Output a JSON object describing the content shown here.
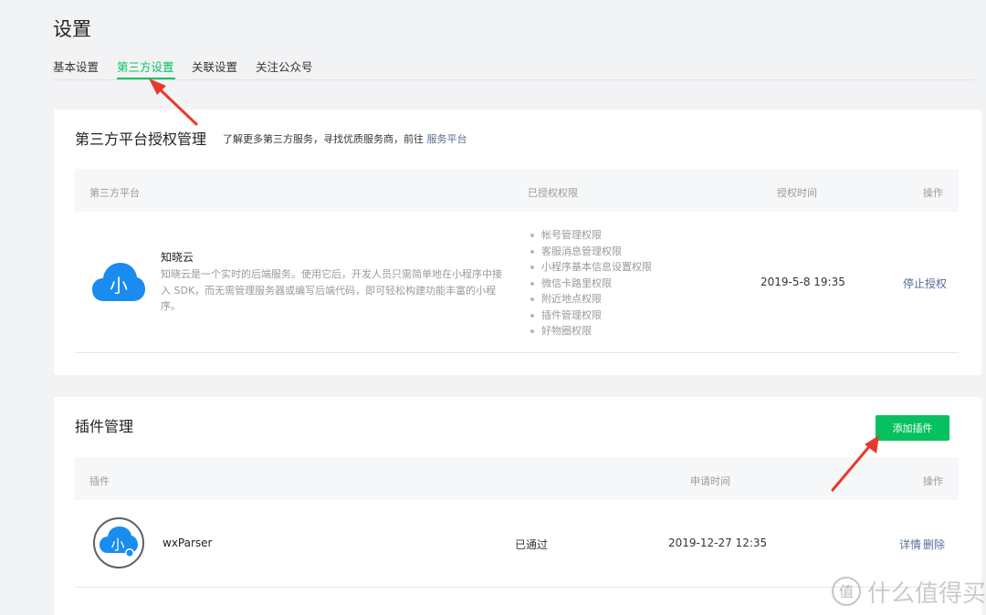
{
  "page": {
    "title": "设置"
  },
  "tabs": [
    {
      "label": "基本设置"
    },
    {
      "label": "第三方设置"
    },
    {
      "label": "关联设置"
    },
    {
      "label": "关注公众号"
    }
  ],
  "third_party": {
    "title": "第三方平台授权管理",
    "desc_prefix": "了解更多第三方服务，寻找优质服务商，前往",
    "desc_link": "服务平台",
    "columns": [
      "第三方平台",
      "已授权权限",
      "授权时间",
      "操作"
    ],
    "row": {
      "icon_glyph": "小",
      "name": "知晓云",
      "desc": "知晓云是一个实时的后端服务。使用它后，开发人员只需简单地在小程序中接入 SDK，而无需管理服务器或编写后端代码，即可轻松构建功能丰富的小程序。",
      "permissions": [
        "帐号管理权限",
        "客服消息管理权限",
        "小程序基本信息设置权限",
        "微信卡路里权限",
        "附近地点权限",
        "插件管理权限",
        "好物圈权限"
      ],
      "time": "2019-5-8 19:35",
      "action": "停止授权"
    }
  },
  "plugins": {
    "title": "插件管理",
    "add_button": "添加插件",
    "columns": [
      "插件",
      "申请时间",
      "操作"
    ],
    "row": {
      "icon_glyph": "小",
      "name": "wxParser",
      "status": "已通过",
      "time": "2019-12-27 12:35",
      "action_detail": "详情",
      "action_delete": "删除"
    }
  },
  "watermark": {
    "glyph": "值",
    "text": "什么值得买"
  },
  "colors": {
    "accent": "#07c160",
    "link": "#576b95",
    "annotation_arrow": "#e8392d",
    "cloud": "#1a8cf0"
  }
}
